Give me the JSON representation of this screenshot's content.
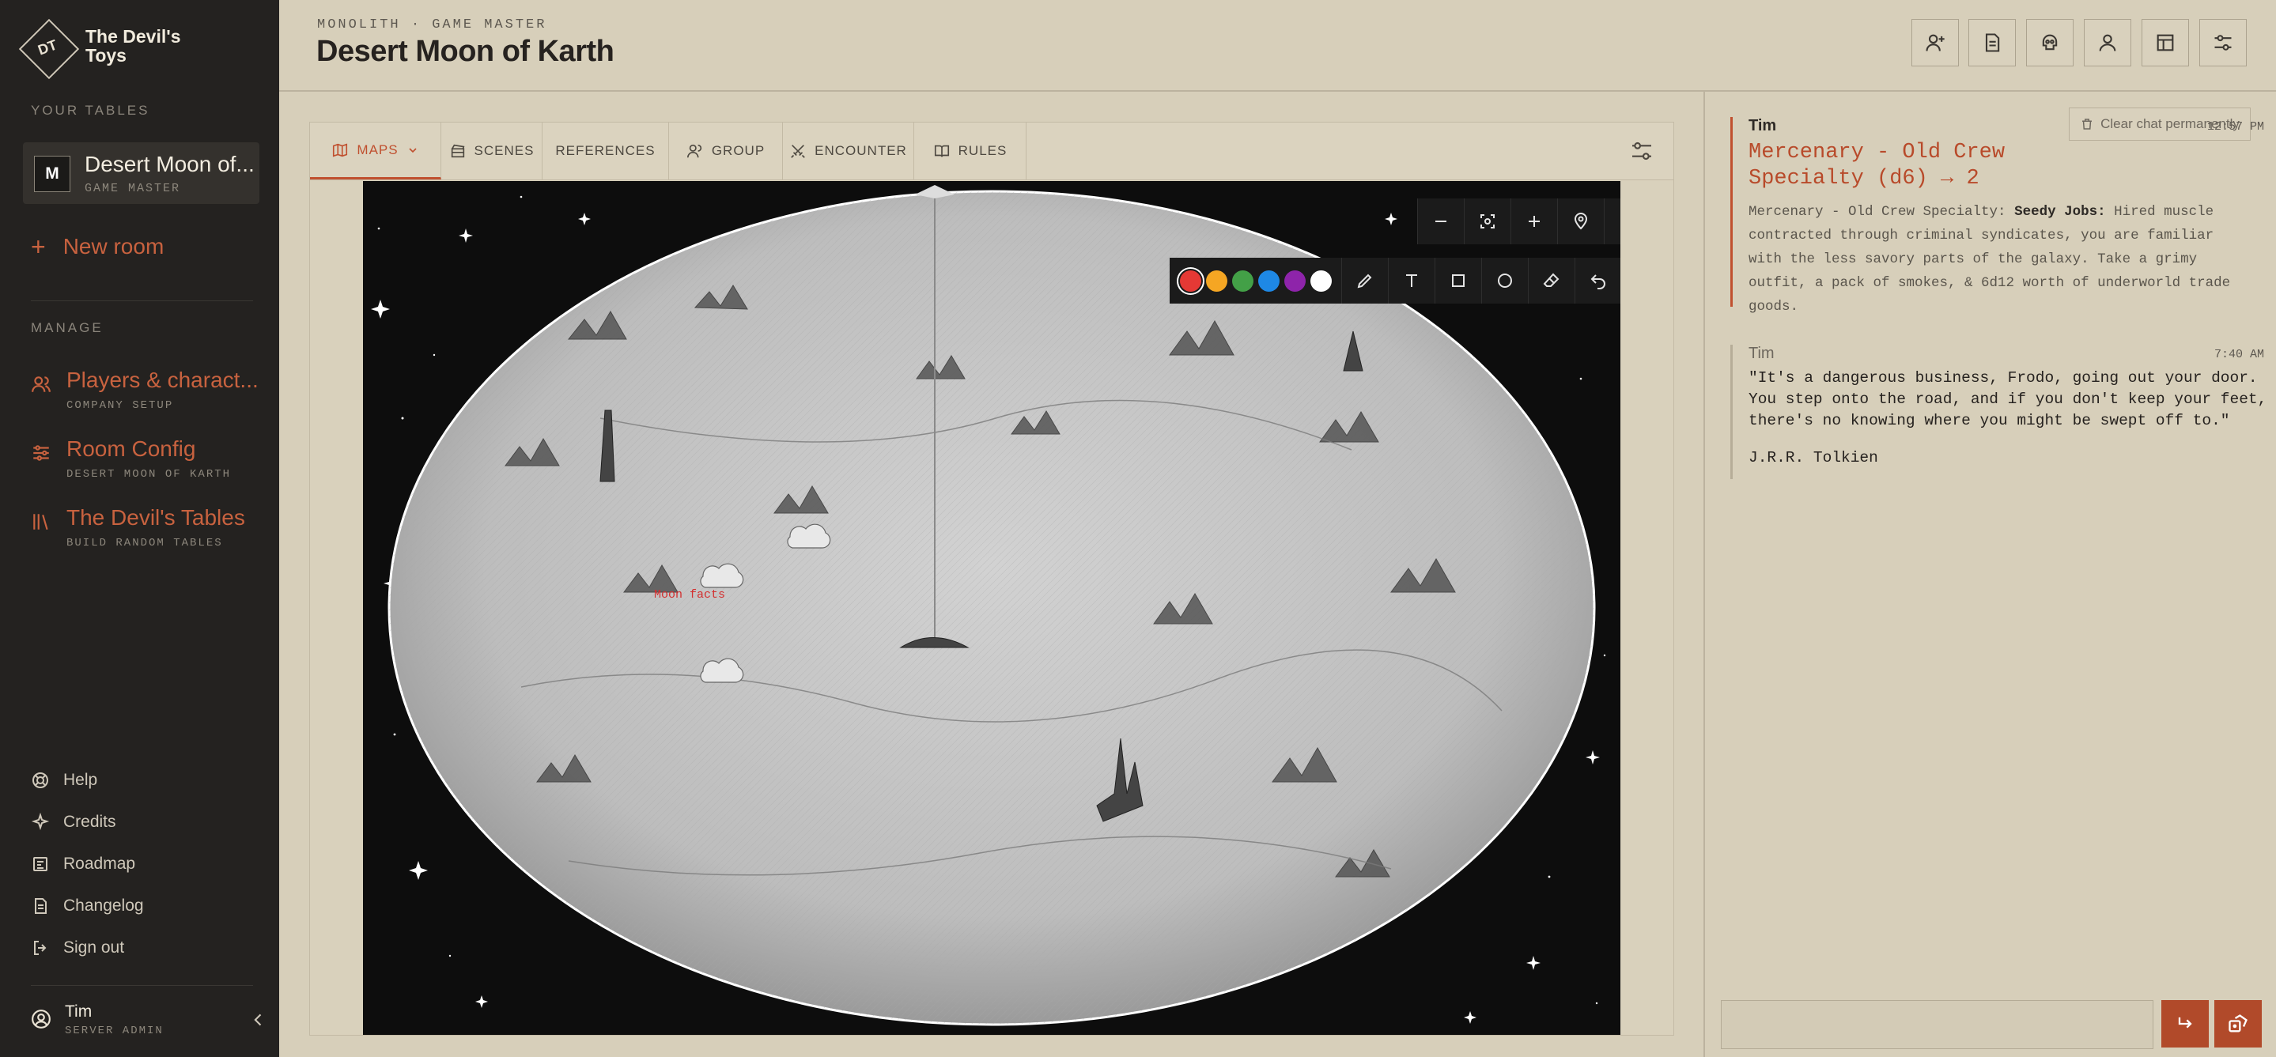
{
  "brand": {
    "logo_mark": "DT",
    "name": "The Devil's Toys"
  },
  "sidebar": {
    "your_tables_label": "YOUR TABLES",
    "table": {
      "badge": "M",
      "name": "Desert Moon of...",
      "role": "GAME MASTER"
    },
    "new_room_label": "New room",
    "manage_label": "MANAGE",
    "manage_items": [
      {
        "title": "Players & charact...",
        "subtitle": "COMPANY SETUP",
        "icon": "users-icon"
      },
      {
        "title": "Room Config",
        "subtitle": "DESERT MOON OF KARTH",
        "icon": "sliders-icon"
      },
      {
        "title": "The Devil's Tables",
        "subtitle": "BUILD RANDOM TABLES",
        "icon": "library-icon"
      }
    ],
    "links": [
      {
        "label": "Help",
        "icon": "lifebuoy-icon"
      },
      {
        "label": "Credits",
        "icon": "sparkles-icon"
      },
      {
        "label": "Roadmap",
        "icon": "roadmap-icon"
      },
      {
        "label": "Changelog",
        "icon": "document-icon"
      },
      {
        "label": "Sign out",
        "icon": "sign-out-icon"
      }
    ],
    "user": {
      "name": "Tim",
      "role": "SERVER ADMIN"
    }
  },
  "header": {
    "breadcrumb": "MONOLITH · GAME MASTER",
    "title": "Desert Moon of Karth",
    "buttons": [
      "add-user-icon",
      "notes-icon",
      "skull-icon",
      "user-icon",
      "table-icon",
      "settings-sliders-icon"
    ]
  },
  "tabs": [
    {
      "label": "MAPS",
      "icon": "map-icon",
      "active": true
    },
    {
      "label": "SCENES",
      "icon": "scenes-icon",
      "active": false
    },
    {
      "label": "REFERENCES",
      "icon": "",
      "active": false
    },
    {
      "label": "GROUP",
      "icon": "group-icon",
      "active": false
    },
    {
      "label": "ENCOUNTER",
      "icon": "swords-icon",
      "active": false
    },
    {
      "label": "RULES",
      "icon": "book-icon",
      "active": false
    }
  ],
  "map": {
    "annotation": "Moon facts",
    "view_tools": [
      "zoom-out-icon",
      "fit-screen-icon",
      "zoom-in-icon",
      "pin-icon",
      "expand-icon"
    ],
    "draw_colors": [
      "#e53935",
      "#f5a623",
      "#43a047",
      "#1e88e5",
      "#8e24aa",
      "#ffffff"
    ],
    "draw_tools": [
      "pencil-icon",
      "text-icon",
      "rectangle-icon",
      "circle-icon",
      "eraser-icon",
      "undo-icon",
      "trash-icon"
    ]
  },
  "chat": {
    "clear_label": "Clear chat permanently",
    "messages": [
      {
        "author": "Tim",
        "time": "12:57 PM",
        "roll_title": "Mercenary - Old Crew Specialty (d6) → 2",
        "prefix": "Mercenary - Old Crew Specialty:",
        "bold": "Seedy Jobs:",
        "body": "Hired muscle contracted through criminal syndicates, you are familiar with the less savory parts of the galaxy. Take a grimy outfit, a pack of smokes, & 6d12 worth of underworld trade goods."
      },
      {
        "author": "Tim",
        "time": "7:40 AM",
        "quote": "\"It's a dangerous business, Frodo, going out your door. You step onto the road, and if you don't keep your feet, there's no knowing where you might be swept off to.\"",
        "attribution": "J.R.R. Tolkien"
      }
    ],
    "input_value": ""
  },
  "colors": {
    "accent": "#c0502f",
    "sidebar_bg": "#242220",
    "page_bg": "#d7cfba"
  }
}
